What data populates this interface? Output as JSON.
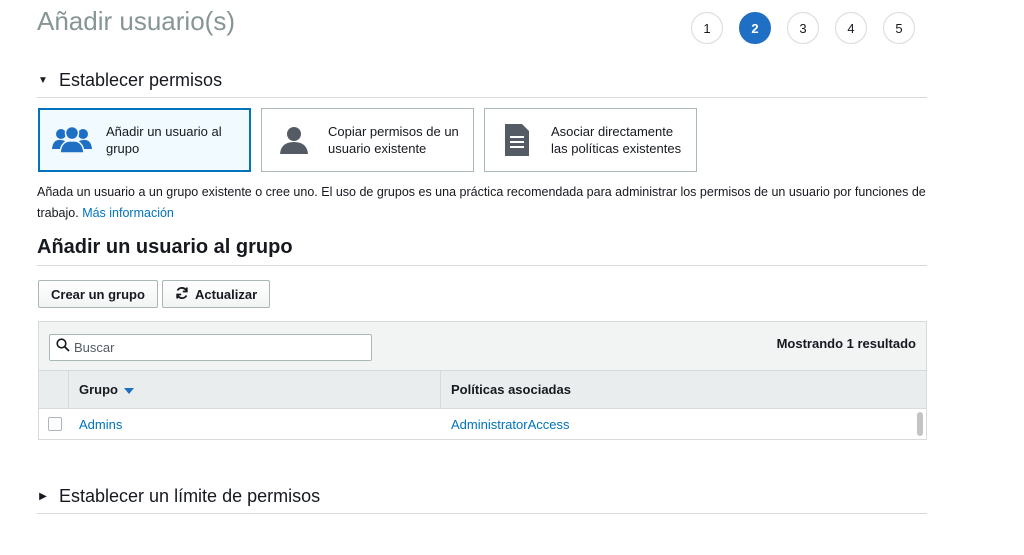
{
  "page": {
    "title": "Añadir usuario(s)"
  },
  "steps": [
    {
      "label": "1",
      "active": false
    },
    {
      "label": "2",
      "active": true
    },
    {
      "label": "3",
      "active": false
    },
    {
      "label": "4",
      "active": false
    },
    {
      "label": "5",
      "active": false
    }
  ],
  "permissions_section": {
    "caret_icon": "caret-down-icon",
    "label": "Establecer permisos",
    "options": [
      {
        "icon": "user-group-icon",
        "label": "Añadir un usuario al grupo",
        "selected": true
      },
      {
        "icon": "user-icon",
        "label": "Copiar permisos de un usuario existente",
        "selected": false
      },
      {
        "icon": "document-icon",
        "label": "Asociar directamente las políticas existentes",
        "selected": false
      }
    ],
    "help_text": "Añada un usuario a un grupo existente o cree uno. El uso de grupos es una práctica recomendada para administrar los permisos de un usuario por funciones de trabajo.",
    "help_link": "Más información"
  },
  "group_section": {
    "title": "Añadir un usuario al grupo",
    "create_button": "Crear un grupo",
    "refresh_button": "Actualizar",
    "refresh_icon": "refresh-icon",
    "search": {
      "icon": "search-icon",
      "placeholder": "Buscar",
      "value": ""
    },
    "result_count": "Mostrando 1 resultado",
    "columns": {
      "group": "Grupo",
      "policies": "Políticas asociadas"
    },
    "sort_icon": "sort-down-icon",
    "rows": [
      {
        "checked": false,
        "group": "Admins",
        "policies": "AdministratorAccess"
      }
    ]
  },
  "boundary_section": {
    "caret_icon": "caret-right-icon",
    "label": "Establecer un límite de permisos"
  },
  "colors": {
    "accent": "#1f6fc5",
    "link": "#0073bb",
    "selected_bg": "#f1faff",
    "title_gray": "#879596"
  }
}
